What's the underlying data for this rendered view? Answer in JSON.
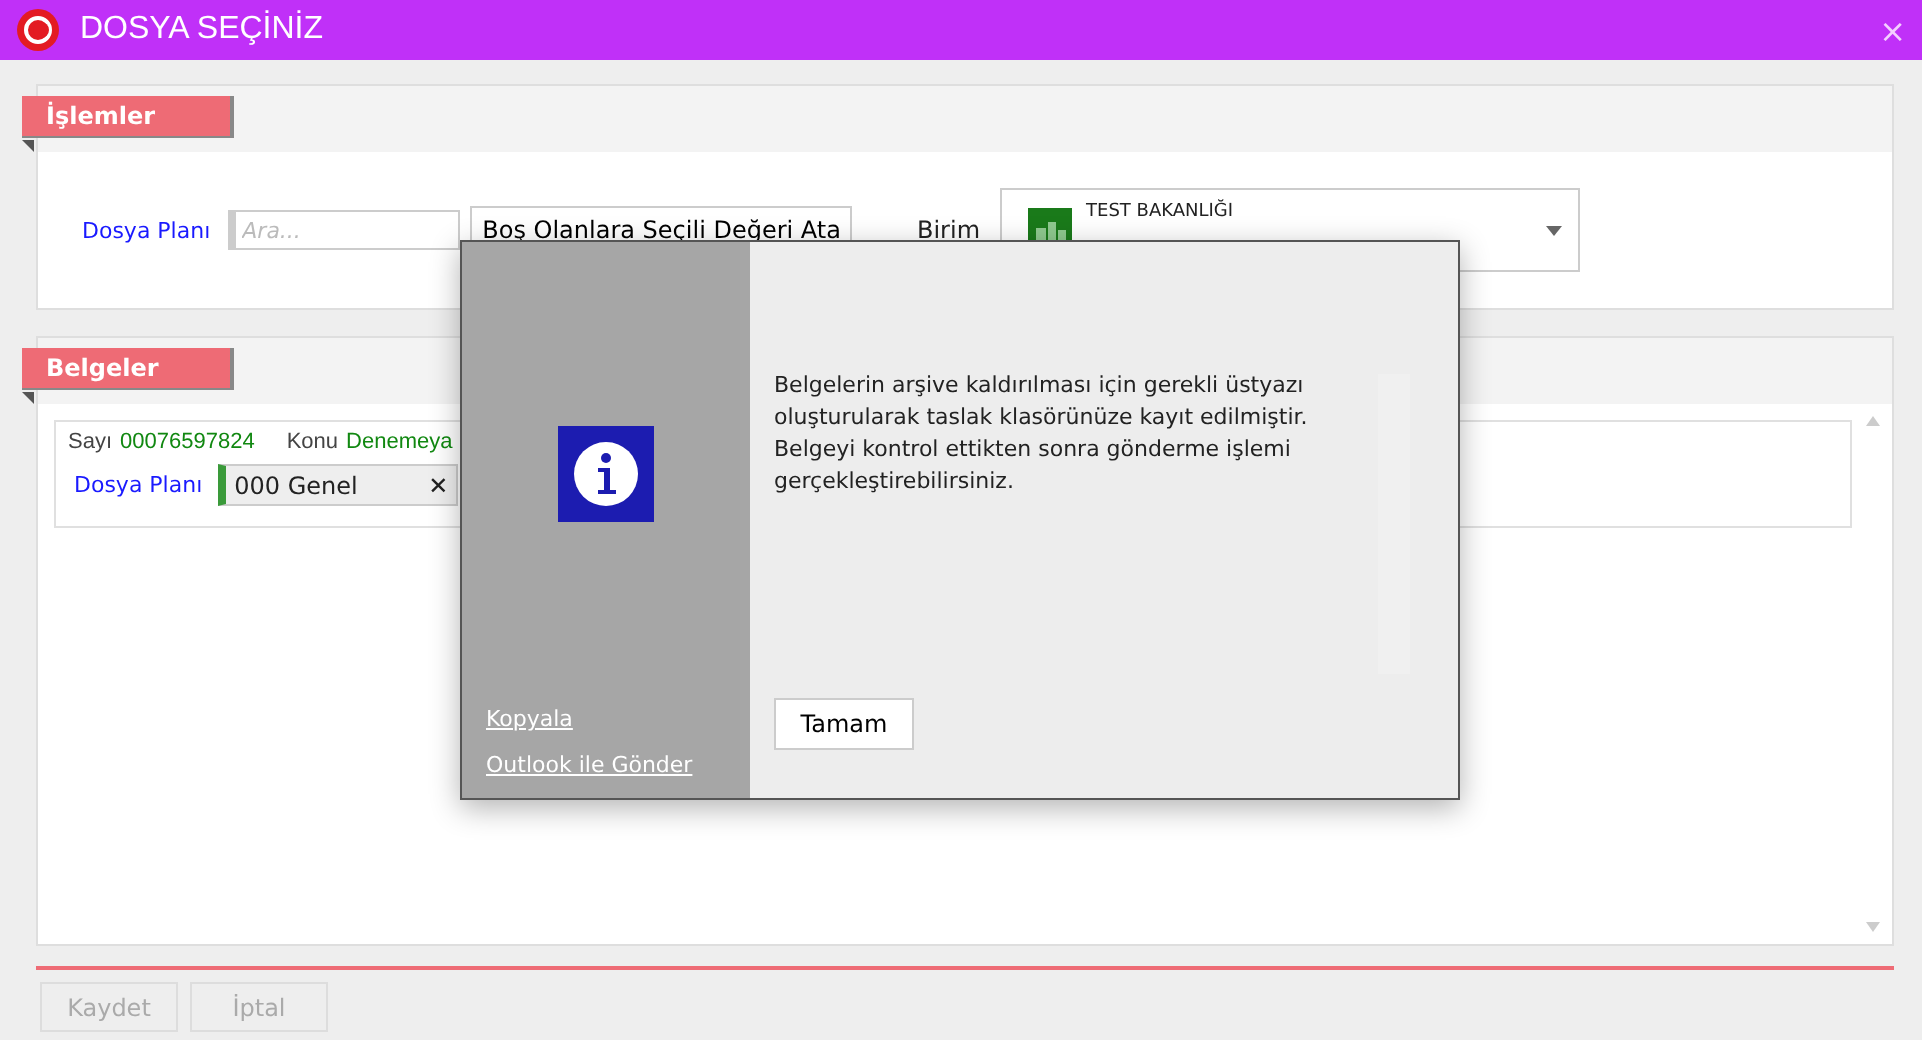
{
  "window": {
    "title": "DOSYA SEÇİNİZ",
    "close": "×"
  },
  "operations": {
    "title": "İşlemler",
    "plan_label": "Dosya Planı",
    "search": {
      "placeholder": "Ara..."
    },
    "assign_button": "Boş Olanlara Seçili Değeri Ata",
    "unit_label": "Birim",
    "unit": {
      "org": "TEST BAKANLIĞI"
    }
  },
  "documents": {
    "title": "Belgeler",
    "rows": [
      {
        "number_label": "Sayı",
        "number": "00076597824",
        "subject_label": "Konu",
        "subject": "Denemeya",
        "plan_label": "Dosya Planı",
        "plan": "000 Genel",
        "remove": "✕"
      }
    ]
  },
  "buttons": [
    {
      "label": "Kaydet",
      "disabled": true
    },
    {
      "label": "İptal",
      "disabled": true
    }
  ],
  "dialog": {
    "message": "Belgelerin arşive kaldırılması için gerekli üstyazı oluşturularak taslak klasörünüze kayıt edilmiştir. Belgeyi kontrol ettikten sonra gönderme işlemi gerçekleştirebilirsiniz.",
    "links": [
      "Kopyala",
      "Outlook ile Gönder"
    ],
    "ok": "Tamam"
  }
}
